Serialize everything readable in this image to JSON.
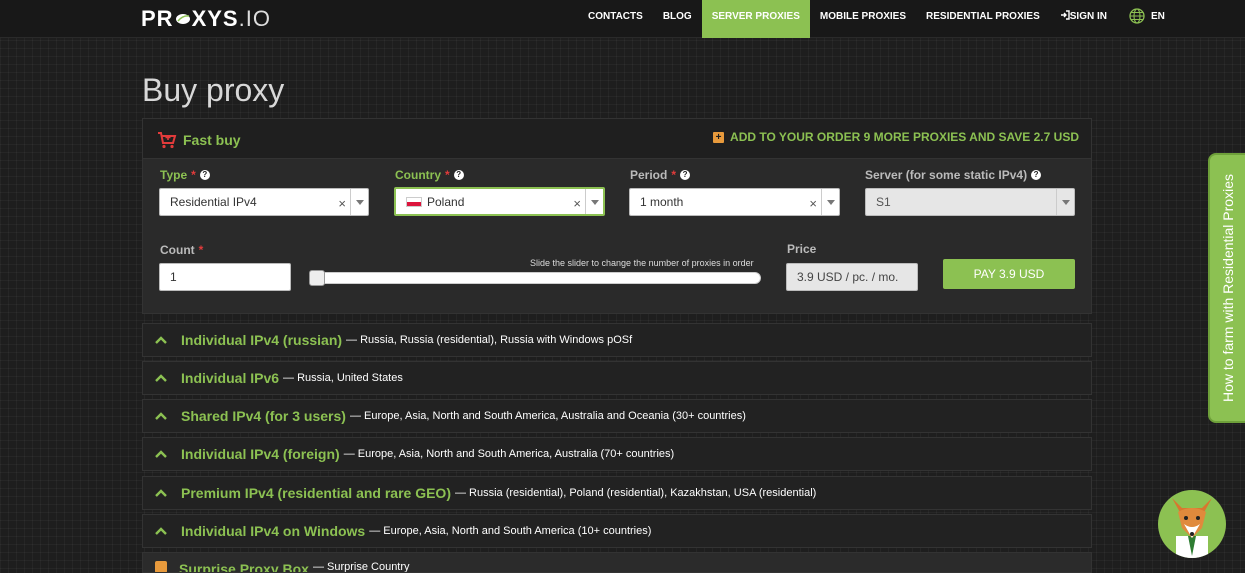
{
  "header": {
    "logo_main": "PR",
    "logo_mid": "XYS",
    "logo_tail": ".IO",
    "nav": [
      {
        "label": "CONTACTS",
        "active": false
      },
      {
        "label": "BLOG",
        "active": false
      },
      {
        "label": "SERVER PROXIES",
        "active": true
      },
      {
        "label": "MOBILE PROXIES",
        "active": false
      },
      {
        "label": "RESIDENTIAL PROXIES",
        "active": false
      }
    ],
    "sign_in": "SIGN IN",
    "language": "EN"
  },
  "page": {
    "title": "Buy proxy"
  },
  "fast_buy": {
    "title": "Fast buy",
    "offer": "ADD TO YOUR ORDER 9 MORE PROXIES AND SAVE 2.7 USD",
    "type": {
      "label": "Type",
      "value": "Residential IPv4"
    },
    "country": {
      "label": "Country",
      "value": "Poland"
    },
    "period": {
      "label": "Period",
      "value": "1 month"
    },
    "server": {
      "label": "Server (for some static IPv4)",
      "value": "S1"
    },
    "count": {
      "label": "Count",
      "value": "1"
    },
    "slider_hint": "Slide the slider to change the number of proxies in order",
    "slider_value": 1,
    "price": {
      "label": "Price",
      "value": "3.9 USD / pc. / mo."
    },
    "pay_label": "PAY 3.9 USD"
  },
  "accordion": [
    {
      "name": "Individual IPv4 (russian)",
      "desc": "— Russia, Russia (residential), Russia with Windows pOSf"
    },
    {
      "name": "Individual IPv6",
      "desc": "— Russia, United States"
    },
    {
      "name": "Shared IPv4 (for 3 users)",
      "desc": "— Europe, Asia, North and South America, Australia and Oceania (30+ countries)"
    },
    {
      "name": "Individual IPv4 (foreign)",
      "desc": "— Europe, Asia, North and South America, Australia (70+ countries)"
    },
    {
      "name": "Premium IPv4 (residential and rare GEO)",
      "desc": "— Russia (residential), Poland (residential), Kazakhstan, USA (residential)"
    },
    {
      "name": "Individual IPv4 on Windows",
      "desc": "— Europe, Asia, North and South America (10+ countries)"
    },
    {
      "name": "Surprise Proxy Box",
      "desc": "— Surprise Country"
    }
  ],
  "side_tab": {
    "label": "How to farm with Residential Proxies"
  },
  "colors": {
    "accent": "#8cc152",
    "required": "#e23b3b",
    "offer_icon": "#e89a3c"
  }
}
